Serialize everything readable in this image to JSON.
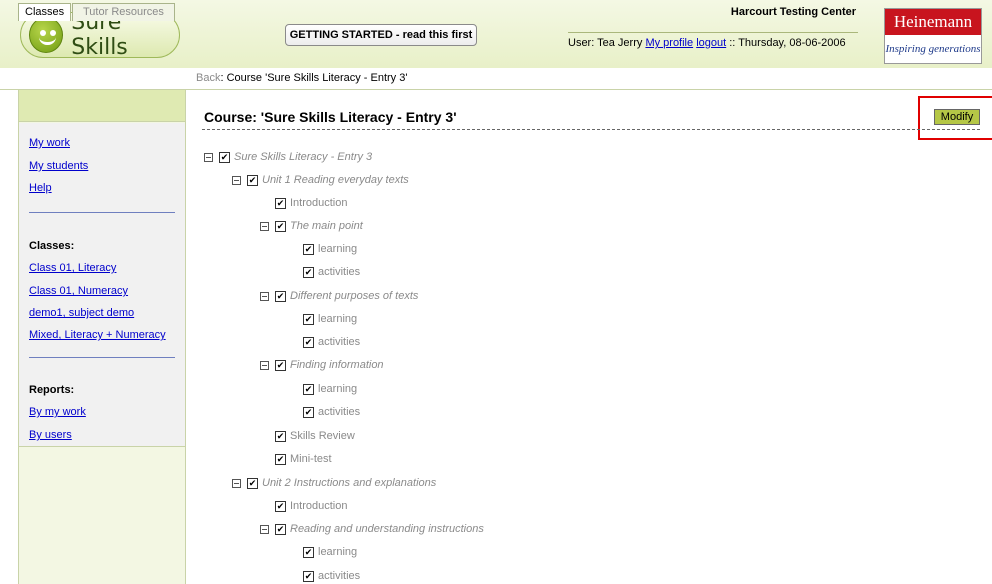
{
  "header": {
    "logo_text": "Sure Skills",
    "getting_started_label": "GETTING STARTED - read this first",
    "center_name": "Harcourt Testing Center",
    "user_prefix": "User: Tea Jerry",
    "my_profile_label": "My profile",
    "logout_label": "logout",
    "date_text": ":: Thursday, 08-06-2006",
    "brand_name": "Heinemann",
    "brand_tagline": "Inspiring generations"
  },
  "tabs": {
    "classes_label": "Classes",
    "tutor_resources_label": "Tutor Resources"
  },
  "breadcrumb": {
    "back_label": "Back",
    "path_text": ": Course 'Sure Skills Literacy - Entry 3'"
  },
  "sidebar": {
    "links": [
      "My work",
      "My students",
      "Help"
    ],
    "classes_heading": "Classes:",
    "classes": [
      "Class 01, Literacy",
      "Class 01, Numeracy",
      "demo1, subject demo",
      "Mixed, Literacy + Numeracy"
    ],
    "reports_heading": "Reports:",
    "reports": [
      "By my work",
      "By users"
    ]
  },
  "main": {
    "course_title": "Course: 'Sure Skills Literacy - Entry 3'",
    "modify_label": "Modify",
    "tree": [
      {
        "label": "Sure Skills Literacy - Entry 3",
        "italic": true,
        "toggle": true,
        "checked": true
      },
      {
        "label": "Unit 1 Reading everyday texts",
        "italic": true,
        "toggle": true,
        "checked": true
      },
      {
        "label": "Introduction",
        "italic": false,
        "toggle": false,
        "checked": true
      },
      {
        "label": "The main point",
        "italic": true,
        "toggle": true,
        "checked": true
      },
      {
        "label": "learning",
        "italic": false,
        "toggle": false,
        "checked": true
      },
      {
        "label": "activities",
        "italic": false,
        "toggle": false,
        "checked": true
      },
      {
        "label": "Different purposes of texts",
        "italic": true,
        "toggle": true,
        "checked": true
      },
      {
        "label": "learning",
        "italic": false,
        "toggle": false,
        "checked": true
      },
      {
        "label": "activities",
        "italic": false,
        "toggle": false,
        "checked": true
      },
      {
        "label": "Finding information",
        "italic": true,
        "toggle": true,
        "checked": true
      },
      {
        "label": "learning",
        "italic": false,
        "toggle": false,
        "checked": true
      },
      {
        "label": "activities",
        "italic": false,
        "toggle": false,
        "checked": true
      },
      {
        "label": "Skills Review",
        "italic": false,
        "toggle": false,
        "checked": true
      },
      {
        "label": "Mini-test",
        "italic": false,
        "toggle": false,
        "checked": true
      },
      {
        "label": "Unit 2 Instructions and explanations",
        "italic": true,
        "toggle": true,
        "checked": true
      },
      {
        "label": "Introduction",
        "italic": false,
        "toggle": false,
        "checked": true
      },
      {
        "label": "Reading and understanding instructions",
        "italic": true,
        "toggle": true,
        "checked": true
      },
      {
        "label": "learning",
        "italic": false,
        "toggle": false,
        "checked": true
      },
      {
        "label": "activities",
        "italic": false,
        "toggle": false,
        "checked": true
      }
    ]
  },
  "colors": {
    "accent_green": "#b5c746",
    "link_blue": "#0000cc",
    "highlight_red": "#e00000",
    "brand_red": "#c8141e"
  }
}
